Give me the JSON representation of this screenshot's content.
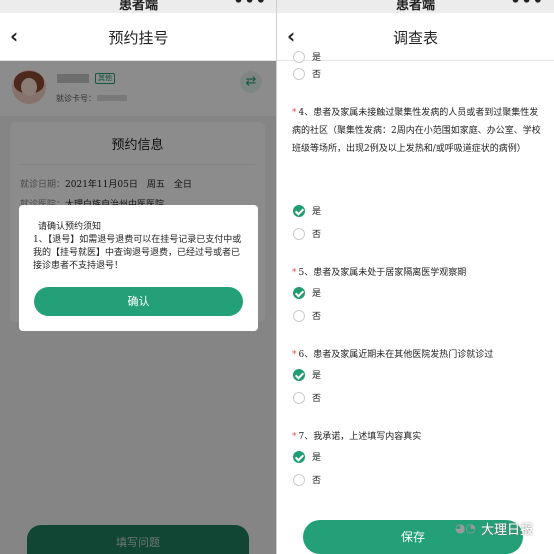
{
  "left": {
    "topbar": {
      "title": "患者端",
      "more": "•••"
    },
    "nav": {
      "back": "‹",
      "title": "预约挂号"
    },
    "profile": {
      "tag": "其他",
      "card_label": "就诊卡号：",
      "switch_icon": "⇄"
    },
    "info": {
      "heading": "预约信息",
      "date_label": "就诊日期：",
      "date_value": "2021年11月05日　周五　全日",
      "hospital_label": "就诊医院：",
      "hospital_value": "大理白族自治州中医医院"
    },
    "dialog": {
      "title": "请确认预约须知",
      "body": "1、【退号】如需退号退费可以在挂号记录已支付中或我的【挂号就医】中查询退号退费，已经过号或者已接诊患者不支持退号！",
      "confirm": "确认"
    },
    "fill_button": "填写问题"
  },
  "right": {
    "topbar": {
      "title": "患者端",
      "more": "•••"
    },
    "nav": {
      "back": "‹",
      "title": "调查表"
    },
    "q_top": {
      "options": [
        {
          "label": "是",
          "checked": false
        },
        {
          "label": "否",
          "checked": false
        }
      ]
    },
    "q4": {
      "text": "4、患者及家属未接触过聚集性发病的人员或者到过聚集性发病的社区（聚集性发病：2周内在小范围如家庭、办公室、学校班级等场所，出现2例及以上发热和/或呼吸道症状的病例）",
      "options": [
        {
          "label": "是",
          "checked": true
        },
        {
          "label": "否",
          "checked": false
        }
      ]
    },
    "q5": {
      "text": "5、患者及家属未处于居家隔离医学观察期",
      "options": [
        {
          "label": "是",
          "checked": true
        },
        {
          "label": "否",
          "checked": false
        }
      ]
    },
    "q6": {
      "text": "6、患者及家属近期未在其他医院发热门诊就诊过",
      "options": [
        {
          "label": "是",
          "checked": true
        },
        {
          "label": "否",
          "checked": false
        }
      ]
    },
    "q7": {
      "text": "7、我承诺，上述填写内容真实",
      "options": [
        {
          "label": "是",
          "checked": true
        },
        {
          "label": "否",
          "checked": false
        }
      ]
    },
    "save": "保存"
  },
  "watermark": {
    "text": "大理日报",
    "icon": "wechat-icon"
  },
  "colors": {
    "accent": "#23a078",
    "required": "#e05050"
  }
}
